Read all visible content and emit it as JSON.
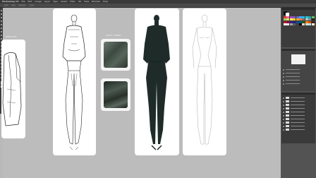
{
  "app": {
    "name": "Photoshop CS",
    "menu": [
      "File",
      "Edit",
      "Image",
      "Layer",
      "Type",
      "Select",
      "Filter",
      "3D",
      "View",
      "Window",
      "Help"
    ]
  },
  "canvas": {
    "swatch_card_label": "PRINT / FABRIC",
    "left_card_label": "SKETCHES",
    "figure_fill": "#1e2b29",
    "fabric_colors": [
      "#4f5c52",
      "#2f3a34"
    ]
  },
  "panels": {
    "swatch_colors": [
      "#e53935",
      "#f06292",
      "#ab47bc",
      "#7e57c2",
      "#5c6bc0",
      "#42a5f5",
      "#29b6f6",
      "#26c6da",
      "#26a69a",
      "#66bb6a",
      "#9ccc65",
      "#d4e157",
      "#ffee58",
      "#ffca28",
      "#ffa726",
      "#ff7043",
      "#8d6e63",
      "#bdbdbd",
      "#78909c",
      "#212121",
      "#b71c1c",
      "#880e4f",
      "#4a148c",
      "#1a237e",
      "#0d47a1",
      "#006064",
      "#1b5e20",
      "#f57f17",
      "#e65100",
      "#3e2723",
      "#ffffff",
      "#eeeeee",
      "#9e9e9e",
      "#616161",
      "#424242",
      "#000000",
      "#ffcdd2",
      "#c8e6c9",
      "#bbdefb",
      "#fff9c4"
    ]
  }
}
